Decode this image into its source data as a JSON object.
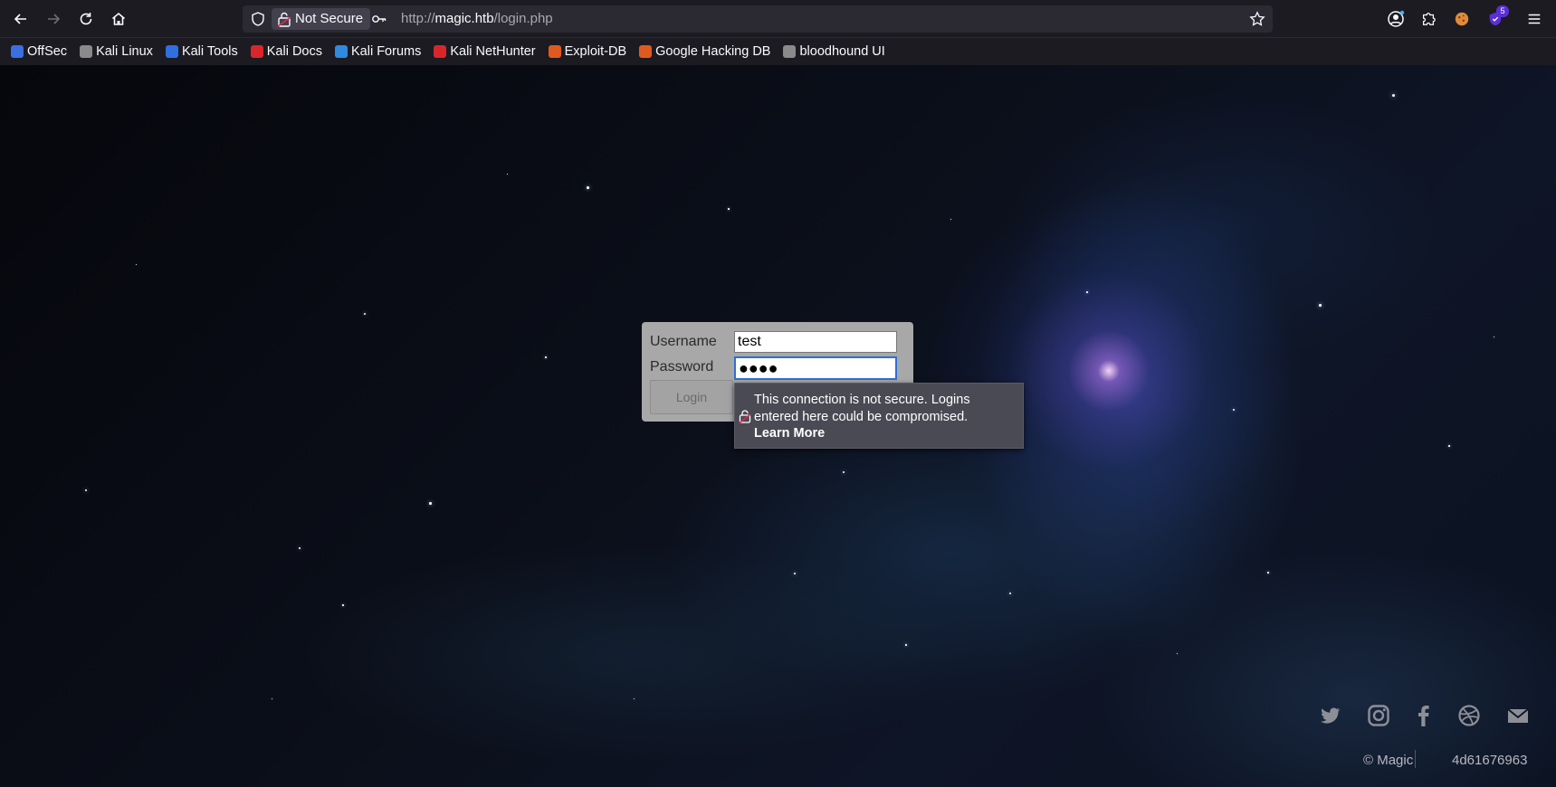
{
  "browser": {
    "security_label": "Not Secure",
    "url_scheme": "http://",
    "url_host": "magic.htb",
    "url_path": "/login.php",
    "extensions_badge": "5"
  },
  "bookmarks": [
    {
      "label": "OffSec",
      "color": "#3b6fe0"
    },
    {
      "label": "Kali Linux",
      "color": "#8a8a8a"
    },
    {
      "label": "Kali Tools",
      "color": "#2f6fe0"
    },
    {
      "label": "Kali Docs",
      "color": "#d9262b"
    },
    {
      "label": "Kali Forums",
      "color": "#2f8ae0"
    },
    {
      "label": "Kali NetHunter",
      "color": "#d9262b"
    },
    {
      "label": "Exploit-DB",
      "color": "#e05a1f"
    },
    {
      "label": "Google Hacking DB",
      "color": "#e05a1f"
    },
    {
      "label": "bloodhound UI",
      "color": "#8a8a8a"
    }
  ],
  "login": {
    "username_label": "Username",
    "password_label": "Password",
    "username_value": "test",
    "password_value": "●●●●",
    "button_label": "Login"
  },
  "tooltip": {
    "message": "This connection is not secure. Logins entered here could be compromised.",
    "link": "Learn More"
  },
  "footer": {
    "copyright": "© Magic",
    "hash": "4d61676963",
    "social_icons": [
      "twitter-icon",
      "instagram-icon",
      "facebook-icon",
      "dribbble-icon",
      "mail-icon"
    ]
  }
}
